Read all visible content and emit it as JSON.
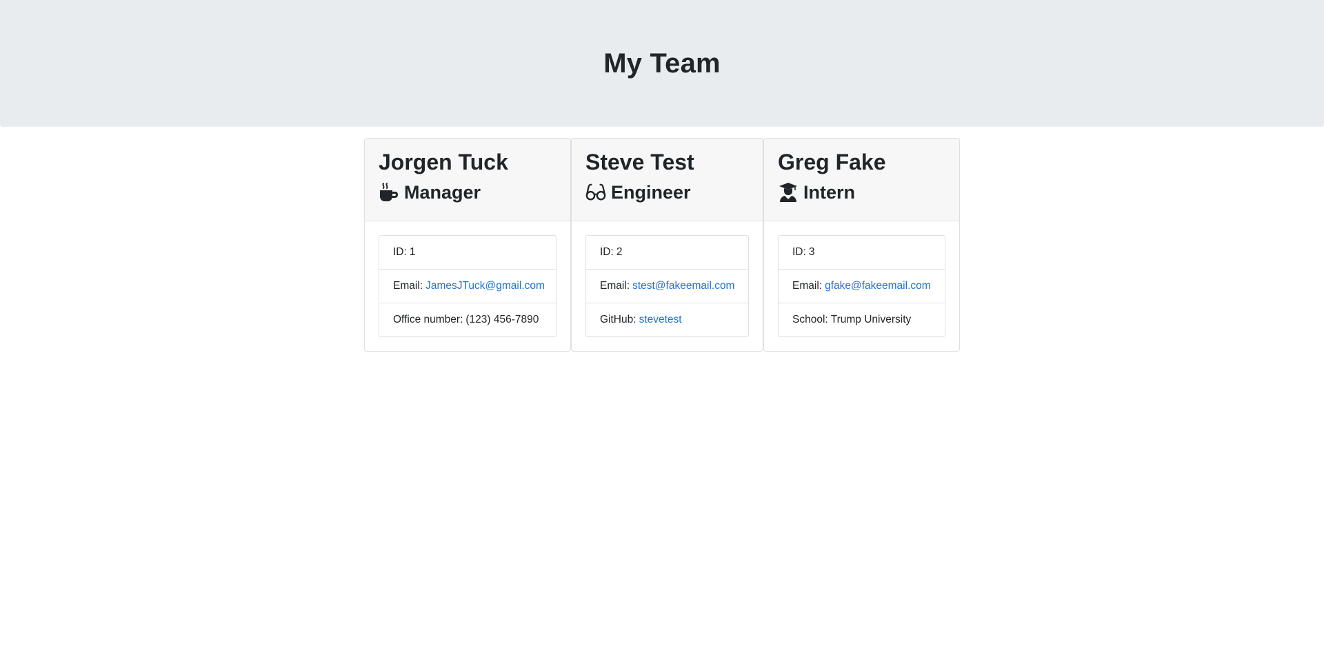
{
  "header": {
    "title": "My Team"
  },
  "team": [
    {
      "name": "Jorgen Tuck",
      "role": "Manager",
      "icon": "mug-icon",
      "id_label": "ID:",
      "id": "1",
      "email_label": "Email:",
      "email": "JamesJTuck@gmail.com",
      "extra_label": "Office number:",
      "extra_value": "(123) 456-7890"
    },
    {
      "name": "Steve Test",
      "role": "Engineer",
      "icon": "glasses-icon",
      "id_label": "ID:",
      "id": "2",
      "email_label": "Email:",
      "email": "stest@fakeemail.com",
      "extra_label": "GitHub:",
      "extra_value": "stevetest"
    },
    {
      "name": "Greg Fake",
      "role": "Intern",
      "icon": "graduate-icon",
      "id_label": "ID:",
      "id": "3",
      "email_label": "Email:",
      "email": "gfake@fakeemail.com",
      "extra_label": "School:",
      "extra_value": "Trump University"
    }
  ],
  "colors": {
    "header_bg": "#e9ecef",
    "link": "#1a73d9",
    "card_header_bg": "#f7f7f7",
    "border": "#dfdfdf"
  }
}
